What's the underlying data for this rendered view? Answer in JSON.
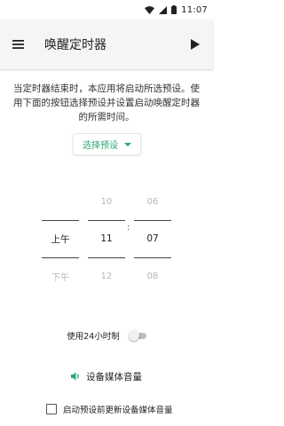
{
  "statusbar": {
    "time": "11:07"
  },
  "appbar": {
    "title": "唤醒定时器"
  },
  "description": "当定时器结束时，本应用将启动所选预设。使用下面的按钮选择预设并设置启动唤醒定时器的所需时间。",
  "preset_button": {
    "label": "选择预设"
  },
  "picker": {
    "ampm": {
      "above": "",
      "selected": "上午",
      "below": "下午"
    },
    "hour": {
      "above": "10",
      "selected": "11",
      "below": "12"
    },
    "minute": {
      "above": "06",
      "selected": "07",
      "below": "08"
    },
    "separator": ":"
  },
  "toggle_24h": {
    "label": "使用24小时制",
    "on": false
  },
  "media_volume": {
    "label": "设备媒体音量"
  },
  "update_volume": {
    "label": "启动预设前更新设备媒体音量",
    "checked": false
  },
  "colors": {
    "accent": "#2ba770",
    "appbar_bg": "#f5f5f5"
  }
}
